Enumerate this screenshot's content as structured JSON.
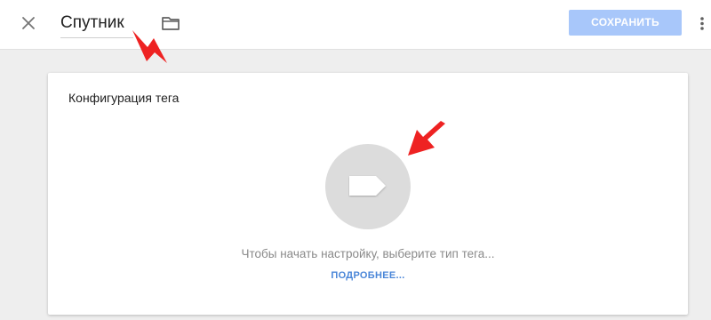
{
  "header": {
    "title": "Спутник",
    "save_label": "СОХРАНИТЬ",
    "close_icon": "close-icon",
    "folder_icon": "folder-icon",
    "more_icon": "more-vert-icon"
  },
  "card": {
    "title": "Конфигурация тега",
    "hint": "Чтобы начать настройку, выберите тип тега...",
    "learn_more": "ПОДРОБНЕЕ...",
    "tag_icon": "tag-icon"
  },
  "colors": {
    "accent": "#4a86d8",
    "save_disabled": "#a8c7fa",
    "annotation_arrow": "#ee2222",
    "background": "#eeeeee"
  }
}
